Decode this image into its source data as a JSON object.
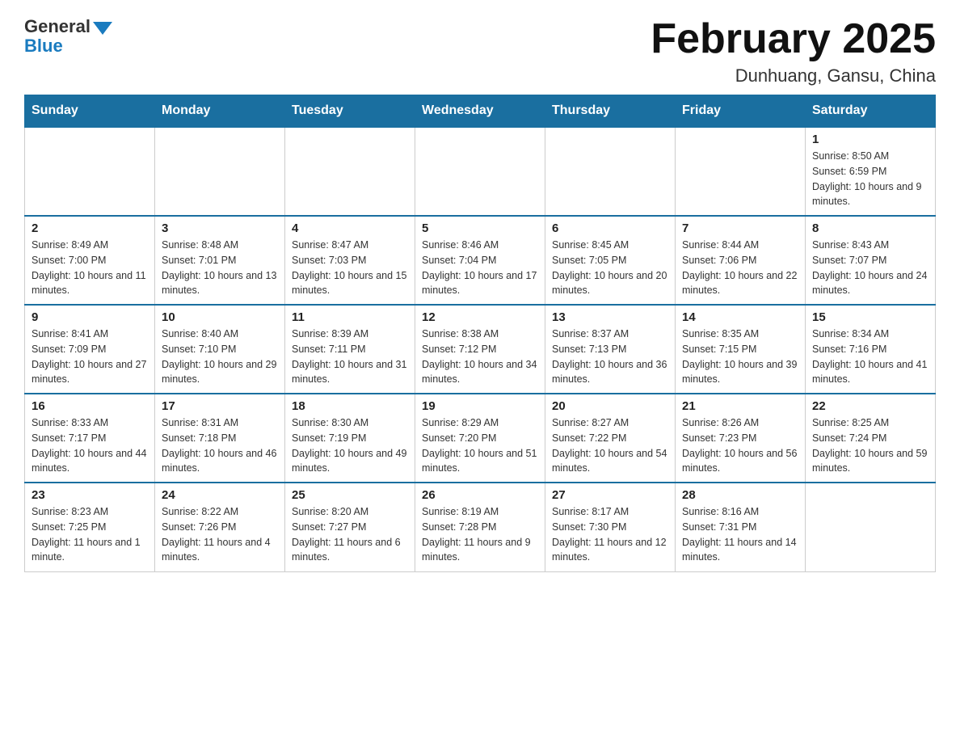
{
  "logo": {
    "general": "General",
    "blue": "Blue"
  },
  "header": {
    "title": "February 2025",
    "subtitle": "Dunhuang, Gansu, China"
  },
  "weekdays": [
    "Sunday",
    "Monday",
    "Tuesday",
    "Wednesday",
    "Thursday",
    "Friday",
    "Saturday"
  ],
  "weeks": [
    [
      {
        "day": "",
        "info": ""
      },
      {
        "day": "",
        "info": ""
      },
      {
        "day": "",
        "info": ""
      },
      {
        "day": "",
        "info": ""
      },
      {
        "day": "",
        "info": ""
      },
      {
        "day": "",
        "info": ""
      },
      {
        "day": "1",
        "info": "Sunrise: 8:50 AM\nSunset: 6:59 PM\nDaylight: 10 hours and 9 minutes."
      }
    ],
    [
      {
        "day": "2",
        "info": "Sunrise: 8:49 AM\nSunset: 7:00 PM\nDaylight: 10 hours and 11 minutes."
      },
      {
        "day": "3",
        "info": "Sunrise: 8:48 AM\nSunset: 7:01 PM\nDaylight: 10 hours and 13 minutes."
      },
      {
        "day": "4",
        "info": "Sunrise: 8:47 AM\nSunset: 7:03 PM\nDaylight: 10 hours and 15 minutes."
      },
      {
        "day": "5",
        "info": "Sunrise: 8:46 AM\nSunset: 7:04 PM\nDaylight: 10 hours and 17 minutes."
      },
      {
        "day": "6",
        "info": "Sunrise: 8:45 AM\nSunset: 7:05 PM\nDaylight: 10 hours and 20 minutes."
      },
      {
        "day": "7",
        "info": "Sunrise: 8:44 AM\nSunset: 7:06 PM\nDaylight: 10 hours and 22 minutes."
      },
      {
        "day": "8",
        "info": "Sunrise: 8:43 AM\nSunset: 7:07 PM\nDaylight: 10 hours and 24 minutes."
      }
    ],
    [
      {
        "day": "9",
        "info": "Sunrise: 8:41 AM\nSunset: 7:09 PM\nDaylight: 10 hours and 27 minutes."
      },
      {
        "day": "10",
        "info": "Sunrise: 8:40 AM\nSunset: 7:10 PM\nDaylight: 10 hours and 29 minutes."
      },
      {
        "day": "11",
        "info": "Sunrise: 8:39 AM\nSunset: 7:11 PM\nDaylight: 10 hours and 31 minutes."
      },
      {
        "day": "12",
        "info": "Sunrise: 8:38 AM\nSunset: 7:12 PM\nDaylight: 10 hours and 34 minutes."
      },
      {
        "day": "13",
        "info": "Sunrise: 8:37 AM\nSunset: 7:13 PM\nDaylight: 10 hours and 36 minutes."
      },
      {
        "day": "14",
        "info": "Sunrise: 8:35 AM\nSunset: 7:15 PM\nDaylight: 10 hours and 39 minutes."
      },
      {
        "day": "15",
        "info": "Sunrise: 8:34 AM\nSunset: 7:16 PM\nDaylight: 10 hours and 41 minutes."
      }
    ],
    [
      {
        "day": "16",
        "info": "Sunrise: 8:33 AM\nSunset: 7:17 PM\nDaylight: 10 hours and 44 minutes."
      },
      {
        "day": "17",
        "info": "Sunrise: 8:31 AM\nSunset: 7:18 PM\nDaylight: 10 hours and 46 minutes."
      },
      {
        "day": "18",
        "info": "Sunrise: 8:30 AM\nSunset: 7:19 PM\nDaylight: 10 hours and 49 minutes."
      },
      {
        "day": "19",
        "info": "Sunrise: 8:29 AM\nSunset: 7:20 PM\nDaylight: 10 hours and 51 minutes."
      },
      {
        "day": "20",
        "info": "Sunrise: 8:27 AM\nSunset: 7:22 PM\nDaylight: 10 hours and 54 minutes."
      },
      {
        "day": "21",
        "info": "Sunrise: 8:26 AM\nSunset: 7:23 PM\nDaylight: 10 hours and 56 minutes."
      },
      {
        "day": "22",
        "info": "Sunrise: 8:25 AM\nSunset: 7:24 PM\nDaylight: 10 hours and 59 minutes."
      }
    ],
    [
      {
        "day": "23",
        "info": "Sunrise: 8:23 AM\nSunset: 7:25 PM\nDaylight: 11 hours and 1 minute."
      },
      {
        "day": "24",
        "info": "Sunrise: 8:22 AM\nSunset: 7:26 PM\nDaylight: 11 hours and 4 minutes."
      },
      {
        "day": "25",
        "info": "Sunrise: 8:20 AM\nSunset: 7:27 PM\nDaylight: 11 hours and 6 minutes."
      },
      {
        "day": "26",
        "info": "Sunrise: 8:19 AM\nSunset: 7:28 PM\nDaylight: 11 hours and 9 minutes."
      },
      {
        "day": "27",
        "info": "Sunrise: 8:17 AM\nSunset: 7:30 PM\nDaylight: 11 hours and 12 minutes."
      },
      {
        "day": "28",
        "info": "Sunrise: 8:16 AM\nSunset: 7:31 PM\nDaylight: 11 hours and 14 minutes."
      },
      {
        "day": "",
        "info": ""
      }
    ]
  ]
}
